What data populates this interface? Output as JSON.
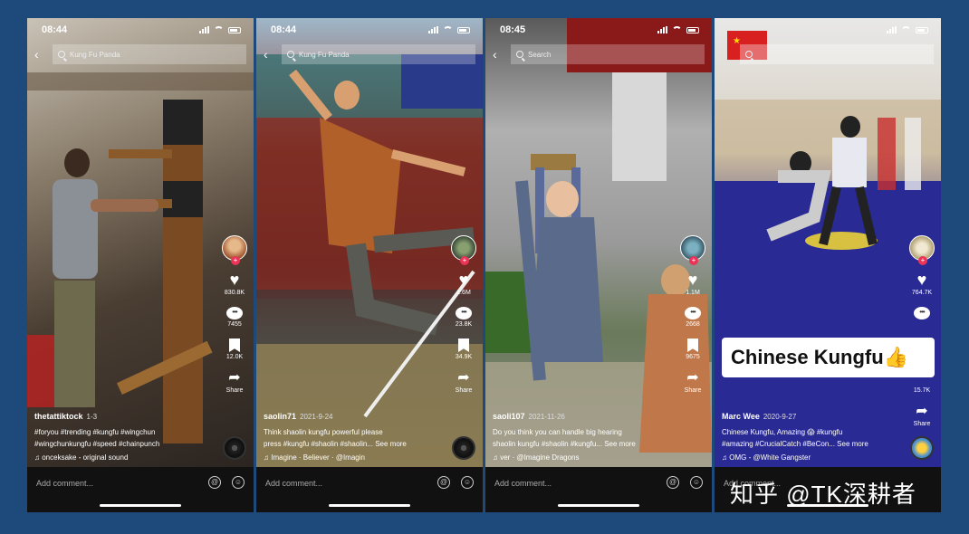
{
  "phones": [
    {
      "time": "08:44",
      "search": "Kung Fu Panda",
      "likes": "830.8K",
      "comments": "7455",
      "bookmarks": "12.0K",
      "share": "Share",
      "user": "thetattiktock",
      "date": "1-3",
      "caption_lines": [
        "#foryou #trending #kungfu #wingchun",
        "#wingchunkungfu #speed #chainpunch"
      ],
      "music": "onceksake - original sound"
    },
    {
      "time": "08:44",
      "search": "Kung Fu Panda",
      "likes": "1.6M",
      "comments": "23.8K",
      "bookmarks": "34.9K",
      "share": "Share",
      "user": "saolin71",
      "date": "2021-9-24",
      "caption_lines": [
        "Think shaolin kungfu powerful please",
        "press #kungfu #shaolin #shaolin... See more"
      ],
      "music": "Imagine · Believer · @Imagin"
    },
    {
      "time": "08:45",
      "search": "Search",
      "likes": "1.1M",
      "comments": "2668",
      "bookmarks": "9675",
      "share": "Share",
      "user": "saoli107",
      "date": "2021-11-26",
      "caption_lines": [
        "Do you think you can handle big hearing",
        "shaolin kungfu #shaolin #kungfu... See more"
      ],
      "music": "ver · @Imagine Dragons"
    },
    {
      "time": "",
      "search": "",
      "likes": "764.7K",
      "comments": "",
      "bookmarks": "15.7K",
      "share": "Share",
      "user": "Marc Wee",
      "date": "2020-9-27",
      "caption_lines": [
        "Chinese Kungfu, Amazing 😱 #kungfu",
        "#amazing #CrucialCatch #BeCon... See more"
      ],
      "music": "OMG - @White Gangster",
      "overlay": "Chinese Kungfu👍"
    }
  ],
  "comment_placeholder": "Add comment...",
  "watermark": "知乎 @TK深耕者",
  "colors": {
    "background": "#1d4a7a",
    "like_plus": "#ea3357"
  }
}
